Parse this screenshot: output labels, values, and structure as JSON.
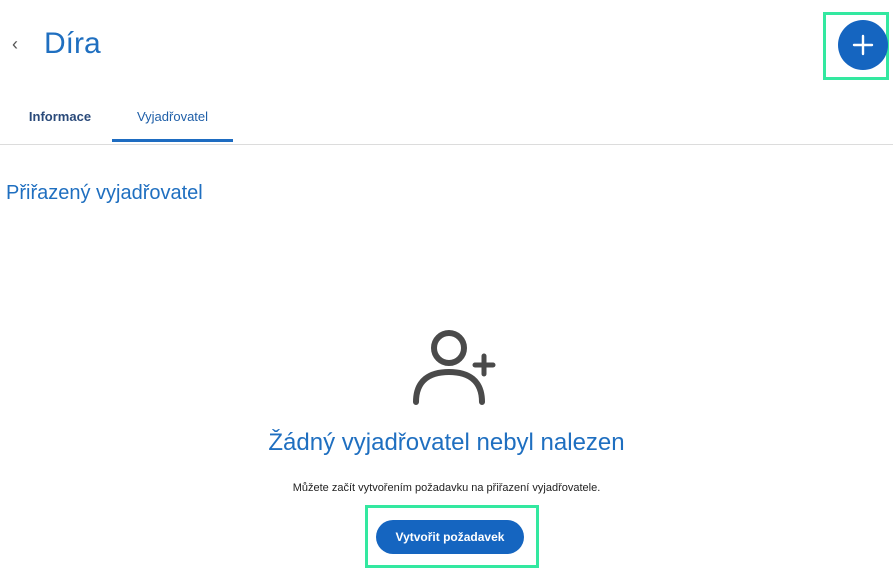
{
  "header": {
    "back_glyph": "‹",
    "title": "Díra",
    "add_icon": "plus-icon"
  },
  "tabs": [
    {
      "label": "Informace",
      "active": false
    },
    {
      "label": "Vyjadřovatel",
      "active": true
    }
  ],
  "section": {
    "title": "Přiřazený vyjadřovatel"
  },
  "empty_state": {
    "icon": "add-person-icon",
    "title": "Žádný vyjadřovatel nebyl nalezen",
    "subtitle": "Můžete začít vytvořením požadavku na přiřazení vyjadřovatele.",
    "button_label": "Vytvořit požadavek"
  },
  "colors": {
    "accent": "#1f6fc0",
    "button": "#1565c0",
    "highlight": "#33e8a0",
    "icon": "#4a4a4a"
  }
}
